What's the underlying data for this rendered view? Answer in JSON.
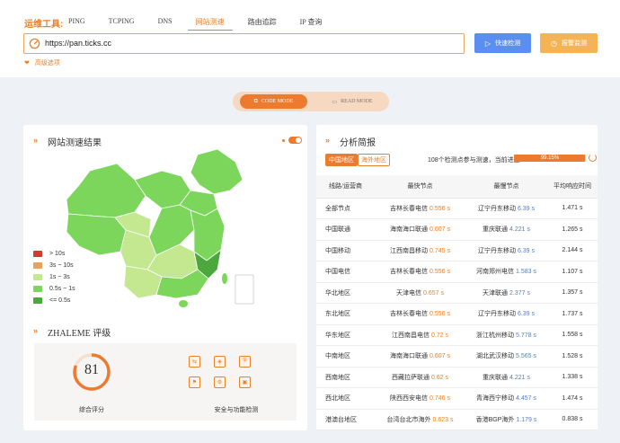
{
  "toolbar": {
    "label": "运维工具:",
    "tabs": [
      "PING",
      "TCPING",
      "DNS",
      "网站测速",
      "路由追踪",
      "IP 查询"
    ],
    "active_tab": 3,
    "url_value": "https://pan.ticks.cc",
    "quick_button": "快速检测",
    "monitor_button": "报警监测",
    "advanced": "高级选项"
  },
  "mode": {
    "code": "CODE MODE",
    "read": "READ MODE"
  },
  "left_panel": {
    "title": "网站测速结果",
    "legend": [
      {
        "label": "> 10s",
        "color": "#d33a2f"
      },
      {
        "label": "3s ~ 10s",
        "color": "#e7a35a"
      },
      {
        "label": "1s ~ 3s",
        "color": "#c3e88f"
      },
      {
        "label": "0.5s ~ 1s",
        "color": "#7cd65b"
      },
      {
        "label": "<= 0.5s",
        "color": "#4aa83c"
      }
    ],
    "rating_title": "ZHALEME 评级",
    "score": "81",
    "score_fraction": 0.81,
    "score_label": "综合评分",
    "security_label": "安全与功能检测"
  },
  "right_panel": {
    "title": "分析简报",
    "filter_cn": "中国地区",
    "filter_overseas": "海外地区",
    "progress_text": "108个检测点参与测速，当前进度",
    "progress_value": "99.15%",
    "progress_fraction": 0.9915,
    "columns": [
      "线路/运营商",
      "最快节点",
      "最慢节点",
      "平均响应时间"
    ],
    "rows": [
      {
        "line": "全部节点",
        "fast_node": "吉林长春电信",
        "fast_time": "0.556 s",
        "slow_node": "辽宁丹东移动",
        "slow_time": "6.39 s",
        "avg": "1.471 s"
      },
      {
        "line": "中国联通",
        "fast_node": "海南海口联通",
        "fast_time": "0.607 s",
        "slow_node": "重庆联通",
        "slow_time": "4.221 s",
        "avg": "1.265 s"
      },
      {
        "line": "中国移动",
        "fast_node": "江西南昌移动",
        "fast_time": "0.745 s",
        "slow_node": "辽宁丹东移动",
        "slow_time": "6.39 s",
        "avg": "2.144 s"
      },
      {
        "line": "中国电信",
        "fast_node": "吉林长春电信",
        "fast_time": "0.556 s",
        "slow_node": "河南郑州电信",
        "slow_time": "1.583 s",
        "avg": "1.107 s"
      },
      {
        "line": "华北地区",
        "fast_node": "天津电信",
        "fast_time": "0.657 s",
        "slow_node": "天津联通",
        "slow_time": "2.377 s",
        "avg": "1.357 s"
      },
      {
        "line": "东北地区",
        "fast_node": "吉林长春电信",
        "fast_time": "0.556 s",
        "slow_node": "辽宁丹东移动",
        "slow_time": "6.39 s",
        "avg": "1.737 s"
      },
      {
        "line": "华东地区",
        "fast_node": "江西南昌电信",
        "fast_time": "0.72 s",
        "slow_node": "浙江杭州移动",
        "slow_time": "5.778 s",
        "avg": "1.558 s"
      },
      {
        "line": "中南地区",
        "fast_node": "海南海口联通",
        "fast_time": "0.607 s",
        "slow_node": "湖北武汉移动",
        "slow_time": "5.565 s",
        "avg": "1.528 s"
      },
      {
        "line": "西南地区",
        "fast_node": "西藏拉萨联通",
        "fast_time": "0.62 s",
        "slow_node": "重庆联通",
        "slow_time": "4.221 s",
        "avg": "1.338 s"
      },
      {
        "line": "西北地区",
        "fast_node": "陕西西安电信",
        "fast_time": "0.746 s",
        "slow_node": "青海西宁移动",
        "slow_time": "4.457 s",
        "avg": "1.474 s"
      },
      {
        "line": "港澳台地区",
        "fast_node": "台湾台北市海外",
        "fast_time": "0.623 s",
        "slow_node": "香港BGP海外",
        "slow_time": "1.179 s",
        "avg": "0.838 s"
      }
    ]
  },
  "colors": {
    "accent": "#e5822c",
    "primary_blue": "#5a8ef0",
    "warn": "#f4b455"
  }
}
